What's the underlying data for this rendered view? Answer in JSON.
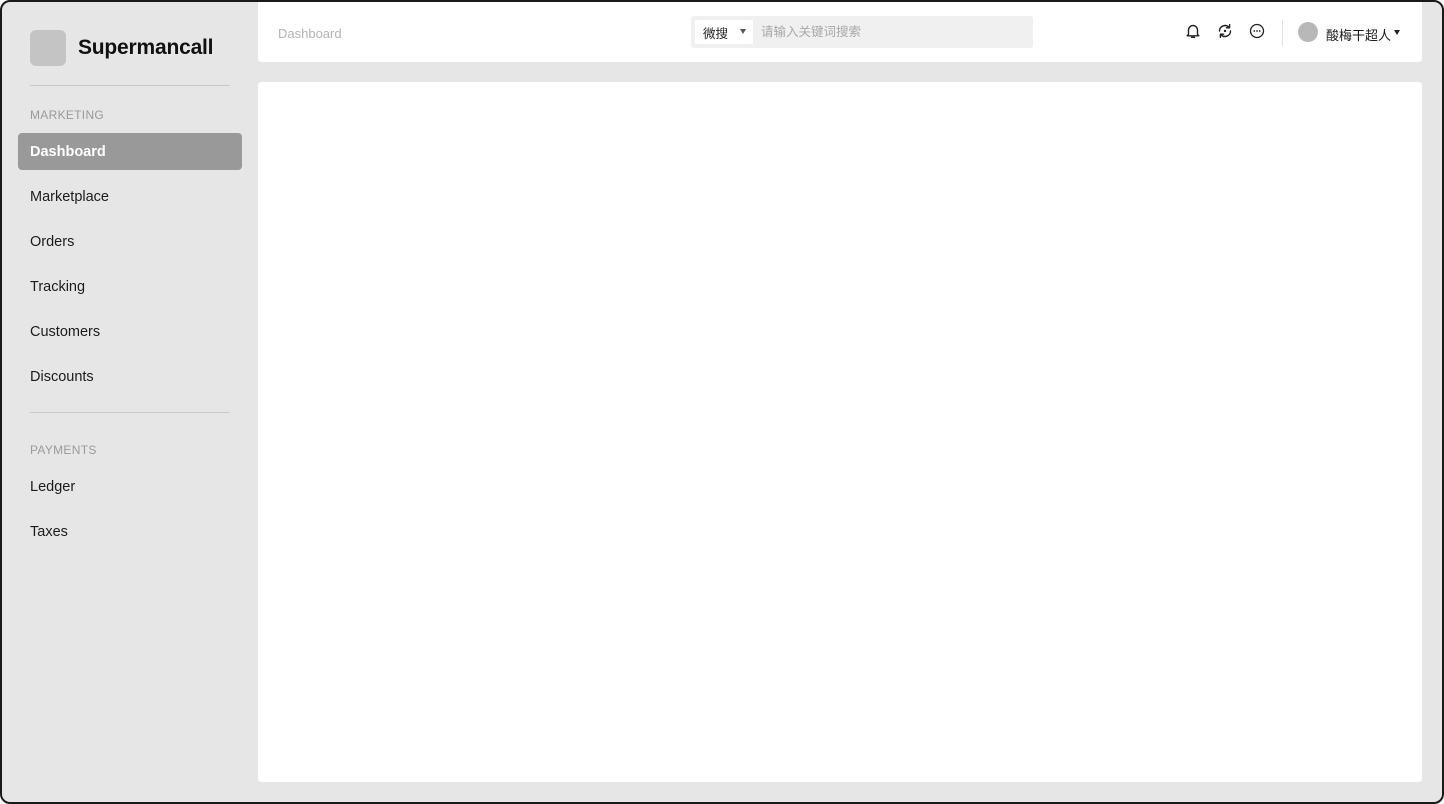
{
  "brand": {
    "name": "Supermancall"
  },
  "sidebar": {
    "sections": [
      {
        "label": "MARKETING",
        "items": [
          {
            "label": "Dashboard",
            "active": true
          },
          {
            "label": "Marketplace"
          },
          {
            "label": "Orders"
          },
          {
            "label": "Tracking"
          },
          {
            "label": "Customers"
          },
          {
            "label": "Discounts"
          }
        ]
      },
      {
        "label": "PAYMENTS",
        "items": [
          {
            "label": "Ledger"
          },
          {
            "label": "Taxes"
          }
        ]
      }
    ]
  },
  "header": {
    "breadcrumb": "Dashboard",
    "search": {
      "scope": "微搜",
      "placeholder": "请输入关键词搜索",
      "value": ""
    },
    "icons": [
      "bell-icon",
      "refresh-icon",
      "more-icon"
    ],
    "user": {
      "name": "酸梅干超人"
    }
  },
  "colors": {
    "background": "#e6e6e6",
    "active_nav": "#999999",
    "panel": "#ffffff"
  }
}
